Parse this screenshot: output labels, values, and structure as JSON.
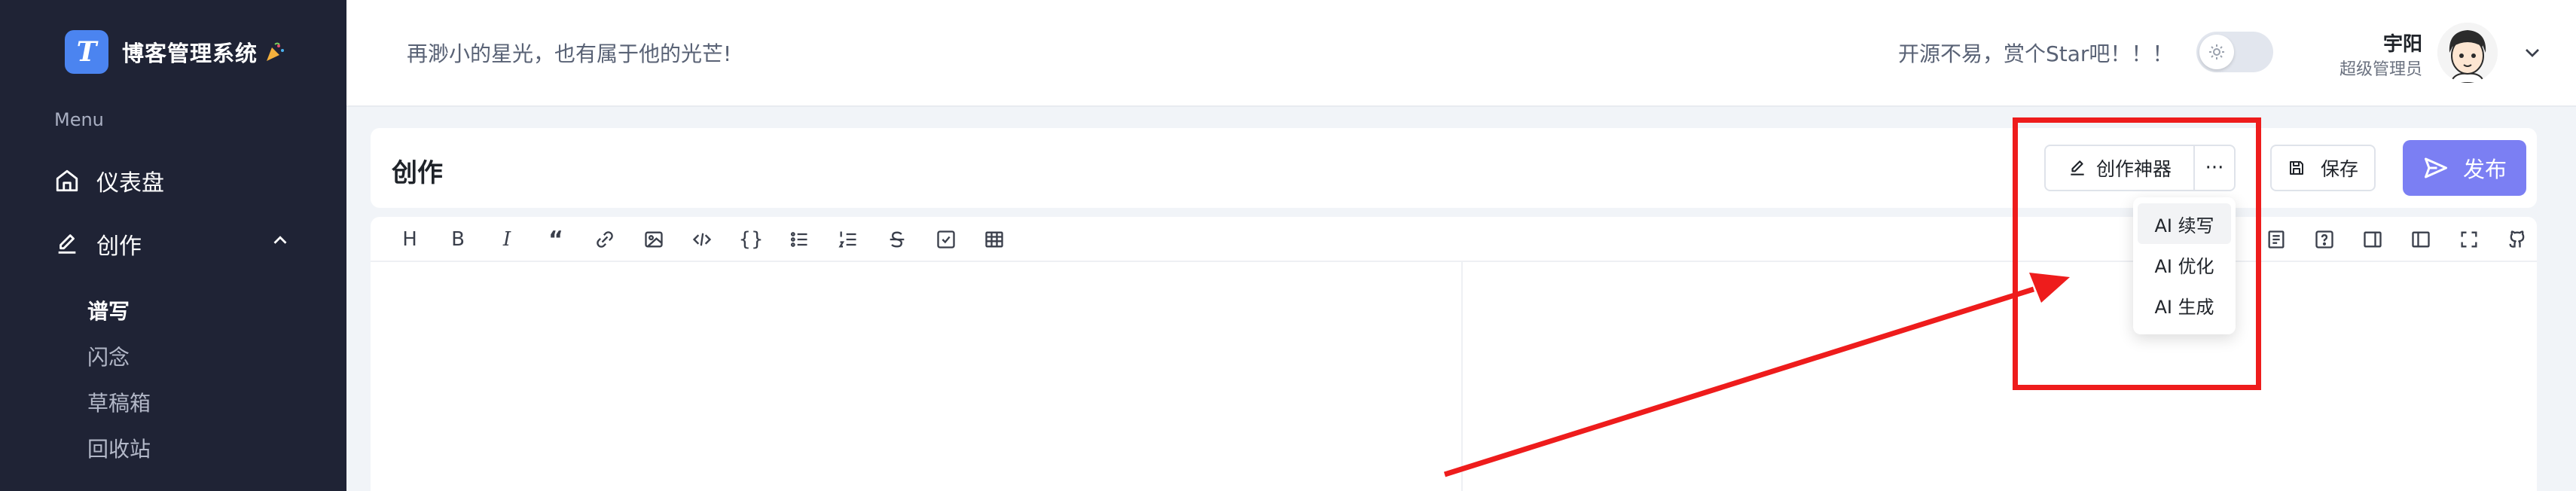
{
  "sidebar": {
    "brand_title": "博客管理系统",
    "logo_letter": "T",
    "menu_heading": "Menu",
    "items": [
      {
        "label": "仪表盘",
        "icon": "home-icon"
      },
      {
        "label": "创作",
        "icon": "edit-icon",
        "expanded": true
      }
    ],
    "sub_items": [
      {
        "label": "谱写",
        "active": true
      },
      {
        "label": "闪念",
        "active": false
      },
      {
        "label": "草稿箱",
        "active": false
      },
      {
        "label": "回收站",
        "active": false
      }
    ]
  },
  "header": {
    "slogan": "再渺小的星光，也有属于他的光芒!",
    "star_text": "开源不易，赏个Star吧！！！",
    "theme_toggle_icon": "sun-icon",
    "user": {
      "name": "宇阳",
      "role": "超级管理员"
    }
  },
  "page": {
    "title": "创作",
    "ai_button_label": "创作神器",
    "more_button_label": "···",
    "save_label": "保存",
    "publish_label": "发布",
    "accent_color": "#7b7ff3"
  },
  "toolbar": {
    "left_tools": [
      "heading-icon",
      "bold-icon",
      "italic-icon",
      "quote-icon",
      "link-icon",
      "image-icon",
      "code-icon",
      "code-block-icon",
      "unordered-list-icon",
      "ordered-list-icon",
      "strikethrough-icon",
      "task-list-icon",
      "table-icon"
    ],
    "right_tools": [
      "toc-icon",
      "help-icon",
      "preview-only-icon",
      "split-view-icon",
      "fullscreen-icon",
      "github-icon"
    ]
  },
  "dropdown": {
    "items": [
      "AI 续写",
      "AI 优化",
      "AI 生成"
    ]
  },
  "annotation": {
    "color": "#ee1c1c"
  }
}
